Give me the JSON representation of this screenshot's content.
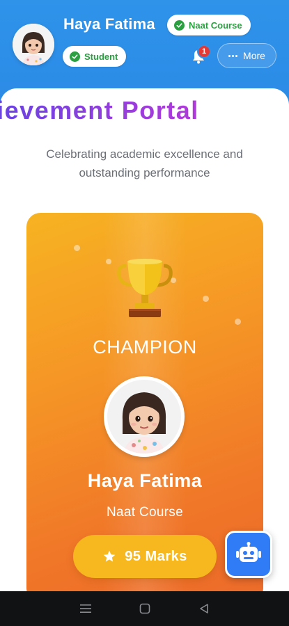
{
  "header": {
    "user_name": "Haya Fatima",
    "course_chip": "Naat Course",
    "role_chip": "Student",
    "notification_count": "1",
    "more_label": "More"
  },
  "page": {
    "title": "Student Achievement Portal",
    "subtitle": "Celebrating academic excellence and outstanding performance"
  },
  "card": {
    "rank_label": "CHAMPION",
    "name": "Haya Fatima",
    "course": "Naat Course",
    "marks_label": "95 Marks",
    "gradient_colors": [
      "#f7b322",
      "#f07628"
    ]
  },
  "colors": {
    "header_blue": "#2f93ea",
    "chip_green": "#2aa040",
    "badge_red": "#e53935",
    "bot_blue": "#2f7cf6",
    "pill_gold": "#f6b81e"
  },
  "icons": {
    "header": [
      "shield-check-icon",
      "bell-icon",
      "dots-icon"
    ],
    "card": [
      "trophy-icon",
      "star-icon"
    ],
    "fab": "robot-icon",
    "nav": [
      "menu-icon",
      "home-icon",
      "back-icon"
    ]
  }
}
